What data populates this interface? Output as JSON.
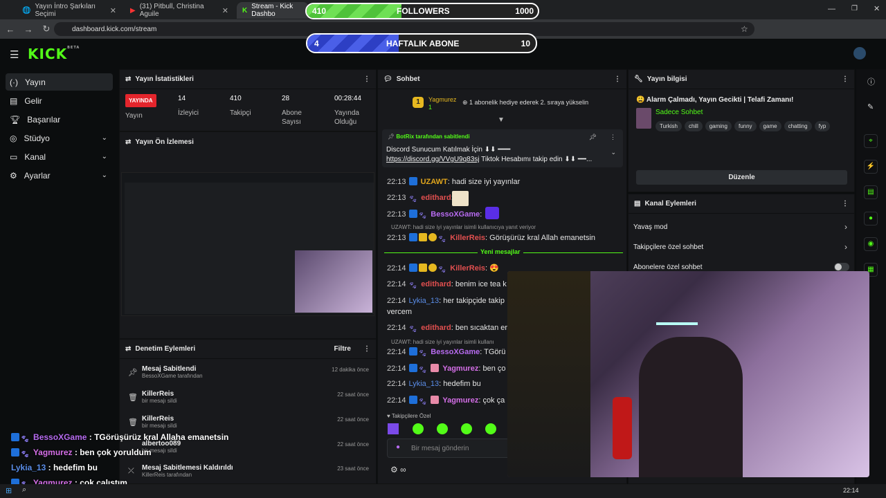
{
  "browser": {
    "tabs": [
      {
        "title": "Yayın İntro Şarkıları Seçimi",
        "active": false
      },
      {
        "title": "(31) Pitbull, Christina Aguile",
        "active": false
      },
      {
        "title": "Stream - Kick Dashbo",
        "active": true
      }
    ],
    "url": "dashboard.kick.com/stream"
  },
  "overlay": {
    "followers": {
      "current": "410",
      "label": "FOLLOWERS",
      "goal": "1000",
      "fraction": 0.41
    },
    "subs": {
      "current": "4",
      "label": "HAFTALIK ABONE",
      "goal": "10",
      "fraction": 0.4
    }
  },
  "brand": {
    "logo": "KICK",
    "beta": "BETA",
    "accent": "#53fc18"
  },
  "sidebar": {
    "items": [
      {
        "label": "Yayın",
        "icon": "broadcast-icon"
      },
      {
        "label": "Gelir",
        "icon": "income-icon"
      },
      {
        "label": "Başarılar",
        "icon": "trophy-icon"
      },
      {
        "label": "Stüdyo",
        "icon": "studio-icon"
      },
      {
        "label": "Kanal",
        "icon": "channel-icon"
      },
      {
        "label": "Ayarlar",
        "icon": "gear-icon"
      }
    ]
  },
  "stats": {
    "title": "Yayın İstatistikleri",
    "live_badge": "YAYINDA",
    "live_label": "Yayın",
    "viewers_value": "14",
    "viewers_label": "İzleyici",
    "followers_value": "410",
    "followers_label": "Takipçi",
    "subs_value": "28",
    "subs_label": "Abone Sayısı",
    "uptime_value": "00:28:44",
    "uptime_label": "Yayında Olduğu"
  },
  "preview": {
    "title": "Yayın Ön İzlemesi"
  },
  "moderation": {
    "title": "Denetim Eylemleri",
    "filter": "Filtre",
    "items": [
      {
        "title": "Mesaj Sabitlendi",
        "sub": "BessoXGame tarafından",
        "time": "12 dakika önce"
      },
      {
        "title": "KillerReis",
        "sub": "bir mesajı sildi",
        "time": "22 saat önce"
      },
      {
        "title": "KillerReis",
        "sub": "bir mesajı sildi",
        "time": "22 saat önce"
      },
      {
        "title": "albertoo089",
        "sub": "bir mesajı sildi",
        "time": "22 saat önce"
      },
      {
        "title": "Mesaj Sabitlemesi Kaldırıldı",
        "sub": "KillerReis tarafından",
        "time": "23 saat önce"
      }
    ]
  },
  "chat": {
    "title": "Sohbet",
    "gift_user": "Yagmurez",
    "gift_count": "1",
    "gift_text": "1 abonelik hediye ederek 2. sıraya yükselin",
    "pinned_by": "BotRix tarafından sabitlendi",
    "pinned_line1": "Discord Sunucum Katılmak İçin ⬇⬇ ━━━",
    "pinned_link": "https://discord.gg/VVgU9q83sj",
    "pinned_line2": "Tiktok Hesabımı takip edin ⬇⬇ ━━...",
    "new_messages": "Yeni mesajlar",
    "followers_only": "Takipçilere Özel",
    "placeholder": "Bir mesaj gönderin",
    "reply_hint": "UZAWT: hadi size iyi yayınlar isimli kullanıcıya yanıt veriyor",
    "reply_hint2": "UZAWT: hadi size iyi yayınlar isimli kullanı",
    "messages": [
      {
        "time": "22:13",
        "user": "UZAWT",
        "text": "hadi size iyi yayınlar"
      },
      {
        "time": "22:13",
        "user": "edithard",
        "text": ""
      },
      {
        "time": "22:13",
        "user": "BessoXGame",
        "text": ""
      },
      {
        "time": "22:13",
        "user": "KillerReis",
        "text": "Görüşürüz kral Allah emanetsin"
      },
      {
        "time": "22:14",
        "user": "KillerReis",
        "text": "😍"
      },
      {
        "time": "22:14",
        "user": "edithard",
        "text": "benim ice tea k"
      },
      {
        "time": "22:14",
        "user": "Lykia_13",
        "text": "her takipçide takip"
      },
      {
        "time": "",
        "user": "",
        "text": "vercem"
      },
      {
        "time": "22:14",
        "user": "edithard",
        "text": "ben sıcaktan er"
      },
      {
        "time": "22:14",
        "user": "BessoXGame",
        "text": "TGörü"
      },
      {
        "time": "22:14",
        "user": "Yagmurez",
        "text": "ben ço"
      },
      {
        "time": "22:14",
        "user": "Lykia_13",
        "text": "hedefim bu"
      },
      {
        "time": "22:14",
        "user": "Yagmurez",
        "text": "çok ça"
      }
    ]
  },
  "info": {
    "title": "Yayın bilgisi",
    "stream_title": "😩 Alarm Çalmadı, Yayın Gecikti | Telafi Zamanı!",
    "category": "Sadece Sohbet",
    "tags": [
      "Turkish",
      "chill",
      "gaming",
      "funny",
      "game",
      "chatting",
      "fyp"
    ],
    "edit": "Düzenle"
  },
  "channel_actions": {
    "title": "Kanal Eylemleri",
    "slow": "Yavaş mod",
    "followers_only": "Takipçilere özel sohbet",
    "subs_only": "Abonelere özel sohbet"
  },
  "overlay_chat": [
    {
      "user": "BessoXGame",
      "text": "TGörüşürüz kral Allaha emanetsin"
    },
    {
      "user": "Yagmurez",
      "text": "ben çok yoruldum"
    },
    {
      "user": "Lykia_13",
      "text": "hedefim bu"
    },
    {
      "user": "Yagmurez",
      "text": "çok çalıştım"
    }
  ],
  "taskbar": {
    "clock": "22:14"
  }
}
